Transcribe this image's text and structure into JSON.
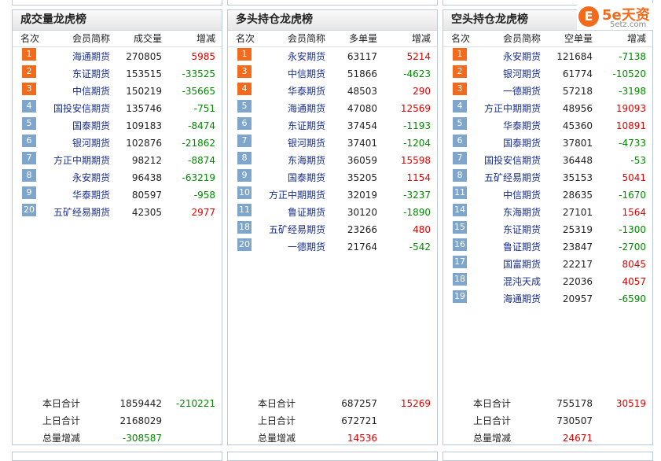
{
  "panels": [
    {
      "title": "成交量龙虎榜",
      "headers": [
        "名次",
        "会员简称",
        "成交量",
        "增减"
      ],
      "rows": [
        {
          "rank": "1",
          "name": "海通期货",
          "volume": "270805",
          "change": "5985",
          "sign": "pos"
        },
        {
          "rank": "2",
          "name": "东证期货",
          "volume": "153515",
          "change": "-33525",
          "sign": "neg"
        },
        {
          "rank": "3",
          "name": "中信期货",
          "volume": "150219",
          "change": "-35665",
          "sign": "neg"
        },
        {
          "rank": "4",
          "name": "国投安信期货",
          "volume": "135746",
          "change": "-751",
          "sign": "neg"
        },
        {
          "rank": "5",
          "name": "国泰期货",
          "volume": "109183",
          "change": "-8474",
          "sign": "neg"
        },
        {
          "rank": "6",
          "name": "银河期货",
          "volume": "102876",
          "change": "-21862",
          "sign": "neg"
        },
        {
          "rank": "7",
          "name": "方正中期期货",
          "volume": "98212",
          "change": "-8874",
          "sign": "neg"
        },
        {
          "rank": "8",
          "name": "永安期货",
          "volume": "96438",
          "change": "-63219",
          "sign": "neg"
        },
        {
          "rank": "9",
          "name": "华泰期货",
          "volume": "80597",
          "change": "-958",
          "sign": "neg"
        },
        {
          "rank": "20",
          "name": "五矿经易期货",
          "volume": "42305",
          "change": "2977",
          "sign": "pos"
        }
      ],
      "totals": [
        {
          "label": "本日合计",
          "volume": "1859442",
          "change": "-210221",
          "vsign": "",
          "csign": "neg"
        },
        {
          "label": "上日合计",
          "volume": "2168029",
          "change": "",
          "vsign": "",
          "csign": ""
        },
        {
          "label": "总量增减",
          "volume": "-308587",
          "change": "",
          "vsign": "neg",
          "csign": ""
        }
      ]
    },
    {
      "title": "多头持仓龙虎榜",
      "headers": [
        "名次",
        "会员简称",
        "多单量",
        "增减"
      ],
      "rows": [
        {
          "rank": "1",
          "name": "永安期货",
          "volume": "63117",
          "change": "5214",
          "sign": "pos"
        },
        {
          "rank": "3",
          "name": "中信期货",
          "volume": "51866",
          "change": "-4623",
          "sign": "neg"
        },
        {
          "rank": "4",
          "name": "华泰期货",
          "volume": "48503",
          "change": "290",
          "sign": "pos"
        },
        {
          "rank": "5",
          "name": "海通期货",
          "volume": "47080",
          "change": "12569",
          "sign": "pos"
        },
        {
          "rank": "6",
          "name": "东证期货",
          "volume": "37454",
          "change": "-1193",
          "sign": "neg"
        },
        {
          "rank": "7",
          "name": "银河期货",
          "volume": "37401",
          "change": "-1204",
          "sign": "neg"
        },
        {
          "rank": "8",
          "name": "东海期货",
          "volume": "36059",
          "change": "15598",
          "sign": "pos"
        },
        {
          "rank": "9",
          "name": "国泰期货",
          "volume": "35205",
          "change": "1154",
          "sign": "pos"
        },
        {
          "rank": "10",
          "name": "方正中期期货",
          "volume": "32019",
          "change": "-3237",
          "sign": "neg"
        },
        {
          "rank": "11",
          "name": "鲁证期货",
          "volume": "30120",
          "change": "-1890",
          "sign": "neg"
        },
        {
          "rank": "18",
          "name": "五矿经易期货",
          "volume": "23266",
          "change": "480",
          "sign": "pos"
        },
        {
          "rank": "20",
          "name": "一德期货",
          "volume": "21764",
          "change": "-542",
          "sign": "neg"
        }
      ],
      "totals": [
        {
          "label": "本日合计",
          "volume": "687257",
          "change": "15269",
          "vsign": "",
          "csign": "pos"
        },
        {
          "label": "上日合计",
          "volume": "672721",
          "change": "",
          "vsign": "",
          "csign": ""
        },
        {
          "label": "总量增减",
          "volume": "14536",
          "change": "",
          "vsign": "pos",
          "csign": ""
        }
      ]
    },
    {
      "title": "空头持仓龙虎榜",
      "headers": [
        "名次",
        "会员简称",
        "空单量",
        "增减"
      ],
      "rows": [
        {
          "rank": "1",
          "name": "永安期货",
          "volume": "121684",
          "change": "-7138",
          "sign": "neg"
        },
        {
          "rank": "2",
          "name": "银河期货",
          "volume": "61774",
          "change": "-10520",
          "sign": "neg"
        },
        {
          "rank": "3",
          "name": "一德期货",
          "volume": "57218",
          "change": "-3198",
          "sign": "neg"
        },
        {
          "rank": "4",
          "name": "方正中期期货",
          "volume": "48956",
          "change": "19093",
          "sign": "pos"
        },
        {
          "rank": "5",
          "name": "华泰期货",
          "volume": "45360",
          "change": "10891",
          "sign": "pos"
        },
        {
          "rank": "6",
          "name": "国泰期货",
          "volume": "37801",
          "change": "-4733",
          "sign": "neg"
        },
        {
          "rank": "7",
          "name": "国投安信期货",
          "volume": "36448",
          "change": "-53",
          "sign": "neg"
        },
        {
          "rank": "8",
          "name": "五矿经易期货",
          "volume": "35153",
          "change": "5041",
          "sign": "pos"
        },
        {
          "rank": "11",
          "name": "中信期货",
          "volume": "28635",
          "change": "-1670",
          "sign": "neg"
        },
        {
          "rank": "14",
          "name": "东海期货",
          "volume": "27101",
          "change": "1564",
          "sign": "pos"
        },
        {
          "rank": "15",
          "name": "东证期货",
          "volume": "25319",
          "change": "-1300",
          "sign": "neg"
        },
        {
          "rank": "16",
          "name": "鲁证期货",
          "volume": "23847",
          "change": "-2700",
          "sign": "neg"
        },
        {
          "rank": "17",
          "name": "国富期货",
          "volume": "22217",
          "change": "8045",
          "sign": "pos"
        },
        {
          "rank": "18",
          "name": "混沌天成",
          "volume": "22036",
          "change": "4057",
          "sign": "pos"
        },
        {
          "rank": "19",
          "name": "海通期货",
          "volume": "20957",
          "change": "-6590",
          "sign": "neg"
        }
      ],
      "totals": [
        {
          "label": "本日合计",
          "volume": "755178",
          "change": "30519",
          "vsign": "",
          "csign": "pos"
        },
        {
          "label": "上日合计",
          "volume": "730507",
          "change": "",
          "vsign": "",
          "csign": ""
        },
        {
          "label": "总量增减",
          "volume": "24671",
          "change": "",
          "vsign": "pos",
          "csign": ""
        }
      ]
    }
  ],
  "logo": {
    "mark": "E",
    "main": "5e天资",
    "sub": "5etz.com",
    "icon": "5e-logo-icon"
  },
  "colors": {
    "top_badge": "#f26b1d",
    "low_badge": "#7ea6cc",
    "up": "#e00000",
    "down": "#008800",
    "name": "#1a2f8a"
  }
}
